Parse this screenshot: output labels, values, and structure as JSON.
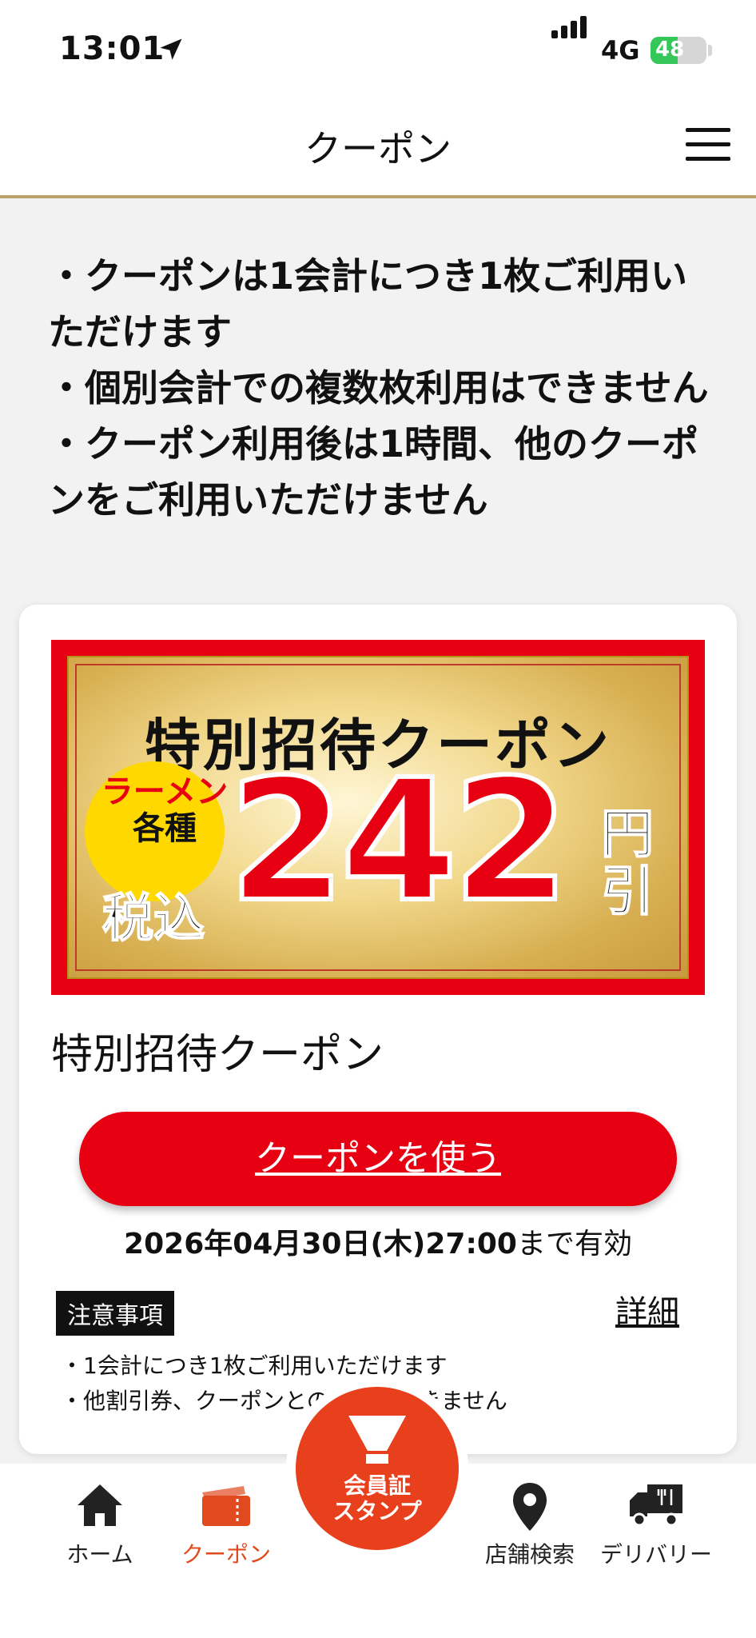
{
  "status_bar": {
    "time": "13:01",
    "network": "4G",
    "battery": "48",
    "battery_level": 0.48
  },
  "header": {
    "title": "クーポン"
  },
  "notice": [
    "・クーポンは1会計につき1枚ご利用いただけます",
    "・個別会計での複数枚利用はできません",
    "・クーポン利用後は1時間、他のクーポンをご利用いただけません"
  ],
  "coupon": {
    "banner": {
      "title": "特別招待クーポン",
      "badge": "ラーメン各種",
      "tax": "税込",
      "amount": "242",
      "unit": "円引"
    },
    "name": "特別招待クーポン",
    "use_button": "クーポンを使う",
    "validity_date": "2026年04月30日(木)27:00",
    "validity_suffix": "まで有効",
    "caution_label": "注意事項",
    "detail_link": "詳細",
    "caution_items": [
      "・1会計につき1枚ご利用いただけます",
      "・他割引券、クーポンとの併用はできません"
    ]
  },
  "bottom_nav": {
    "items": [
      {
        "label": "ホーム",
        "icon": "home-icon"
      },
      {
        "label": "クーポン",
        "icon": "ticket-icon"
      },
      {
        "label": "店舗検索",
        "icon": "map-pin-icon"
      },
      {
        "label": "デリバリー",
        "icon": "delivery-truck-icon"
      }
    ],
    "center_button": {
      "label": "会員証スタンプ",
      "icon": "bowl-icon"
    }
  },
  "colors": {
    "primary_red": "#e60012",
    "nav_active": "#e04a1e",
    "header_border": "#b7a26a",
    "badge_yellow": "#ffd800"
  }
}
